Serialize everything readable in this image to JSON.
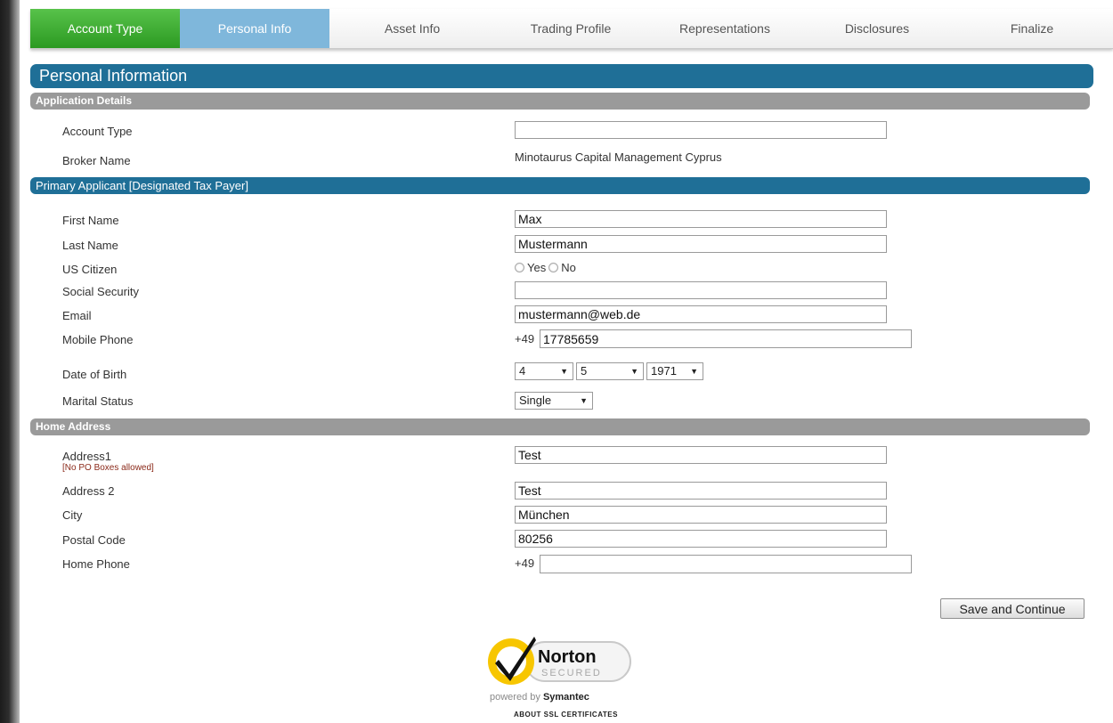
{
  "tabs": [
    {
      "label": "Account Type"
    },
    {
      "label": "Personal Info"
    },
    {
      "label": "Asset Info"
    },
    {
      "label": "Trading Profile"
    },
    {
      "label": "Representations"
    },
    {
      "label": "Disclosures"
    },
    {
      "label": "Finalize"
    }
  ],
  "header": {
    "title": "Personal Information"
  },
  "sections": {
    "application": "Application Details",
    "primary": "Primary Applicant [Designated Tax Payer]",
    "home": "Home Address"
  },
  "application": {
    "account_type_label": "Account Type",
    "account_type_value": "",
    "broker_label": "Broker Name",
    "broker_value": "Minotaurus Capital Management Cyprus"
  },
  "applicant": {
    "first_name_label": "First Name",
    "first_name_value": "Max",
    "last_name_label": "Last Name",
    "last_name_value": "Mustermann",
    "us_citizen_label": "US Citizen",
    "us_yes": "Yes",
    "us_no": "No",
    "ssn_label": "Social Security",
    "ssn_value": "",
    "email_label": "Email",
    "email_value": "mustermann@web.de",
    "mobile_label": "Mobile Phone",
    "mobile_prefix": "+49",
    "mobile_value": "17785659",
    "dob_label": "Date of Birth",
    "dob_day": "4",
    "dob_month": "5",
    "dob_year": "1971",
    "marital_label": "Marital Status",
    "marital_value": "Single"
  },
  "address": {
    "address1_label": "Address1",
    "address1_note": "[No PO Boxes allowed]",
    "address1_value": "Test",
    "address2_label": "Address 2",
    "address2_value": "Test",
    "city_label": "City",
    "city_value": "München",
    "postal_label": "Postal Code",
    "postal_value": "80256",
    "home_phone_label": "Home Phone",
    "home_phone_prefix": "+49",
    "home_phone_value": ""
  },
  "actions": {
    "save": "Save and Continue"
  },
  "seal": {
    "brand": "Norton",
    "secured": "SECURED",
    "powered_by": "powered by",
    "vendor": "Symantec",
    "ssl_link": "ABOUT SSL CERTIFICATES",
    "colors": {
      "yellow": "#f7c600",
      "check": "#111111"
    }
  },
  "colors": {
    "tab_done": "#3aa22c",
    "tab_active": "#7fb7db",
    "header_blue": "#1f6f97",
    "subbar_gray": "#9a9a9a"
  }
}
